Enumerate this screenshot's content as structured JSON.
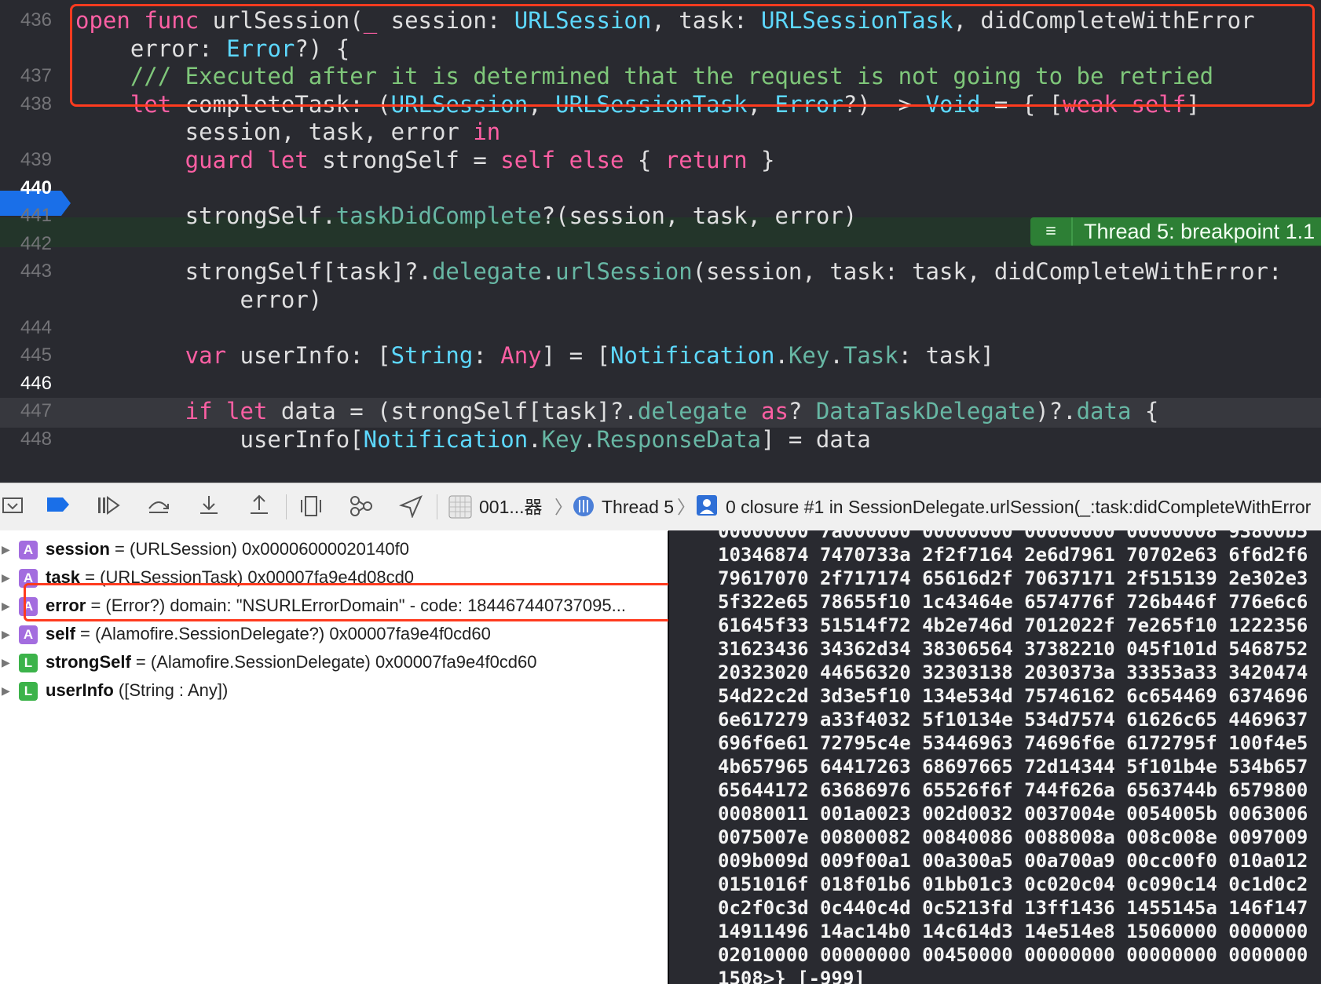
{
  "editor": {
    "lines": [
      {
        "num": "436",
        "parts": [
          [
            "kw",
            "open "
          ],
          [
            "kw",
            "func "
          ],
          [
            "",
            "urlSession("
          ],
          [
            "kw",
            "_ "
          ],
          [
            "",
            "session: "
          ],
          [
            "ty",
            "URLSession"
          ],
          [
            "",
            ", task: "
          ],
          [
            "ty",
            "URLSessionTask"
          ],
          [
            "",
            ", didCompleteWithError"
          ]
        ]
      },
      {
        "num": "",
        "parts": [
          [
            "",
            "    error: "
          ],
          [
            "ty",
            "Error"
          ],
          [
            "",
            "?) {"
          ]
        ]
      },
      {
        "num": "437",
        "parts": [
          [
            "cmt",
            "    /// Executed after it is determined that the request is not going to be retried"
          ]
        ]
      },
      {
        "num": "438",
        "parts": [
          [
            "kw",
            "    let "
          ],
          [
            "",
            "completeTask: ("
          ],
          [
            "ty",
            "URLSession"
          ],
          [
            "",
            ", "
          ],
          [
            "ty",
            "URLSessionTask"
          ],
          [
            "",
            ", "
          ],
          [
            "ty",
            "Error"
          ],
          [
            "",
            "?) -> "
          ],
          [
            "ty",
            "Void"
          ],
          [
            "",
            " = { ["
          ],
          [
            "kw",
            "weak self"
          ],
          [
            "",
            "]"
          ]
        ]
      },
      {
        "num": "",
        "parts": [
          [
            "",
            "        session, task, error "
          ],
          [
            "kw",
            "in"
          ]
        ]
      },
      {
        "num": "439",
        "parts": [
          [
            "kw",
            "        guard let "
          ],
          [
            "",
            "strongSelf = "
          ],
          [
            "kw",
            "self else "
          ],
          [
            "",
            "{ "
          ],
          [
            "kw",
            "return "
          ],
          [
            "",
            "}"
          ]
        ]
      },
      {
        "num": "440",
        "parts": []
      },
      {
        "num": "441",
        "parts": [
          [
            "",
            "        strongSelf."
          ],
          [
            "fn",
            "taskDidComplete"
          ],
          [
            "",
            "?(session, task, error)"
          ]
        ]
      },
      {
        "num": "442",
        "parts": []
      },
      {
        "num": "443",
        "parts": [
          [
            "",
            "        strongSelf[task]?."
          ],
          [
            "fn",
            "delegate"
          ],
          [
            "",
            "."
          ],
          [
            "fn",
            "urlSession"
          ],
          [
            "",
            "(session, task: task, didCompleteWithError:"
          ]
        ]
      },
      {
        "num": "",
        "parts": [
          [
            "",
            "            error)"
          ]
        ]
      },
      {
        "num": "444",
        "parts": []
      },
      {
        "num": "445",
        "parts": [
          [
            "kw",
            "        var "
          ],
          [
            "",
            "userInfo: ["
          ],
          [
            "ty",
            "String"
          ],
          [
            "",
            ": "
          ],
          [
            "kw",
            "Any"
          ],
          [
            "",
            "] = ["
          ],
          [
            "ty",
            "Notification"
          ],
          [
            "",
            "."
          ],
          [
            "fn",
            "Key"
          ],
          [
            "",
            "."
          ],
          [
            "fn",
            "Task"
          ],
          [
            "",
            ": task]"
          ]
        ]
      },
      {
        "num": "446",
        "parts": []
      },
      {
        "num": "447",
        "parts": [
          [
            "kw",
            "        if let "
          ],
          [
            "",
            "data = (strongSelf[task]?."
          ],
          [
            "fn",
            "delegate "
          ],
          [
            "kw",
            "as"
          ],
          [
            "",
            "? "
          ],
          [
            "fn",
            "DataTaskDelegate"
          ],
          [
            "",
            ")?."
          ],
          [
            "fn",
            "data"
          ],
          [
            "",
            " {"
          ]
        ]
      },
      {
        "num": "448",
        "parts": [
          [
            "",
            "            userInfo["
          ],
          [
            "ty",
            "Notification"
          ],
          [
            "",
            "."
          ],
          [
            "fn",
            "Key"
          ],
          [
            "",
            "."
          ],
          [
            "fn",
            "ResponseData"
          ],
          [
            "",
            "] = data"
          ]
        ]
      }
    ],
    "breakpoint_label": "Thread 5: breakpoint 1.1",
    "badge_icon": "≡"
  },
  "toolbar": {
    "frame_label": "001...器",
    "thread_label": "Thread 5",
    "stack_label": "0 closure #1 in SessionDelegate.urlSession(_:task:didCompleteWithError"
  },
  "variables": [
    {
      "kind": "A",
      "name": "session",
      "rest": " = (URLSession) 0x00006000020140f0"
    },
    {
      "kind": "A",
      "name": "task",
      "rest": " = (URLSessionTask) 0x00007fa9e4d08cd0"
    },
    {
      "kind": "A",
      "name": "error",
      "rest": " = (Error?) domain: \"NSURLErrorDomain\" - code: 184467440737095..."
    },
    {
      "kind": "A",
      "name": "self",
      "rest": " = (Alamofire.SessionDelegate?) 0x00007fa9e4f0cd60"
    },
    {
      "kind": "L",
      "name": "strongSelf",
      "rest": " = (Alamofire.SessionDelegate) 0x00007fa9e4f0cd60"
    },
    {
      "kind": "L",
      "name": "userInfo",
      "rest": " ([String : Any])"
    }
  ],
  "console": {
    "lines": [
      "00000000 7a000000 00000000 00000000 00000008 93800b5",
      "10346874 7470733a 2f2f7164 2e6d7961 70702e63 6f6d2f6",
      "79617070 2f717174 65616d2f 70637171 2f515139 2e302e3",
      "5f322e65 78655f10 1c43464e 6574776f 726b446f 776e6c6",
      "61645f33 51514f72 4b2e746d 7012022f 7e265f10 1222356",
      "31623436 34362d34 38306564 37382210 045f101d 5468752",
      "20323020 44656320 32303138 2030373a 33353a33 3420474",
      "54d22c2d 3d3e5f10 134e534d 75746162 6c654469 6374696",
      "6e617279 a33f4032 5f10134e 534d7574 61626c65 4469637",
      "696f6e61 72795c4e 53446963 74696f6e 6172795f 100f4e5",
      "4b657965 64417263 68697665 72d14344 5f101b4e 534b657",
      "65644172 63686976 65526f6f 744f626a 6563744b 6579800",
      "00080011 001a0023 002d0032 0037004e 0054005b 0063006",
      "0075007e 00800082 00840086 0088008a 008c008e 0097009",
      "009b009d 009f00a1 00a300a5 00a700a9 00cc00f0 010a012",
      "0151016f 018f01b6 01bb01c3 0c020c04 0c090c14 0c1d0c2",
      "0c2f0c3d 0c440c4d 0c5213fd 13ff1436 1455145a 146f147",
      "14911496 14ac14b0 14c614d3 14e514e8 15060000 0000000",
      "02010000 00000000 00450000 00000000 00000000 0000000",
      "1508>} [-999]"
    ]
  }
}
